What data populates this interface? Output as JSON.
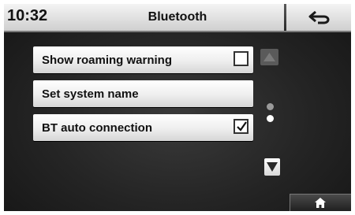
{
  "status_bar": {
    "time": "10:32",
    "title": "Bluetooth",
    "back_icon": "back-arrow-icon"
  },
  "menu": {
    "items": [
      {
        "label": "Show roaming warning",
        "control": "checkbox",
        "checked": false
      },
      {
        "label": "Set system name",
        "control": "none"
      },
      {
        "label": "BT auto connection",
        "control": "checkbox",
        "checked": true
      }
    ]
  },
  "scroll": {
    "up_icon": "triangle-up-icon",
    "down_icon": "triangle-down-icon",
    "page_count": 2,
    "current_page": 2
  },
  "bottom_bar": {
    "home_icon": "home-icon"
  },
  "colors": {
    "background": "#242424",
    "row_background": "#eeeeee",
    "top_bar": "#dcdcdc"
  }
}
